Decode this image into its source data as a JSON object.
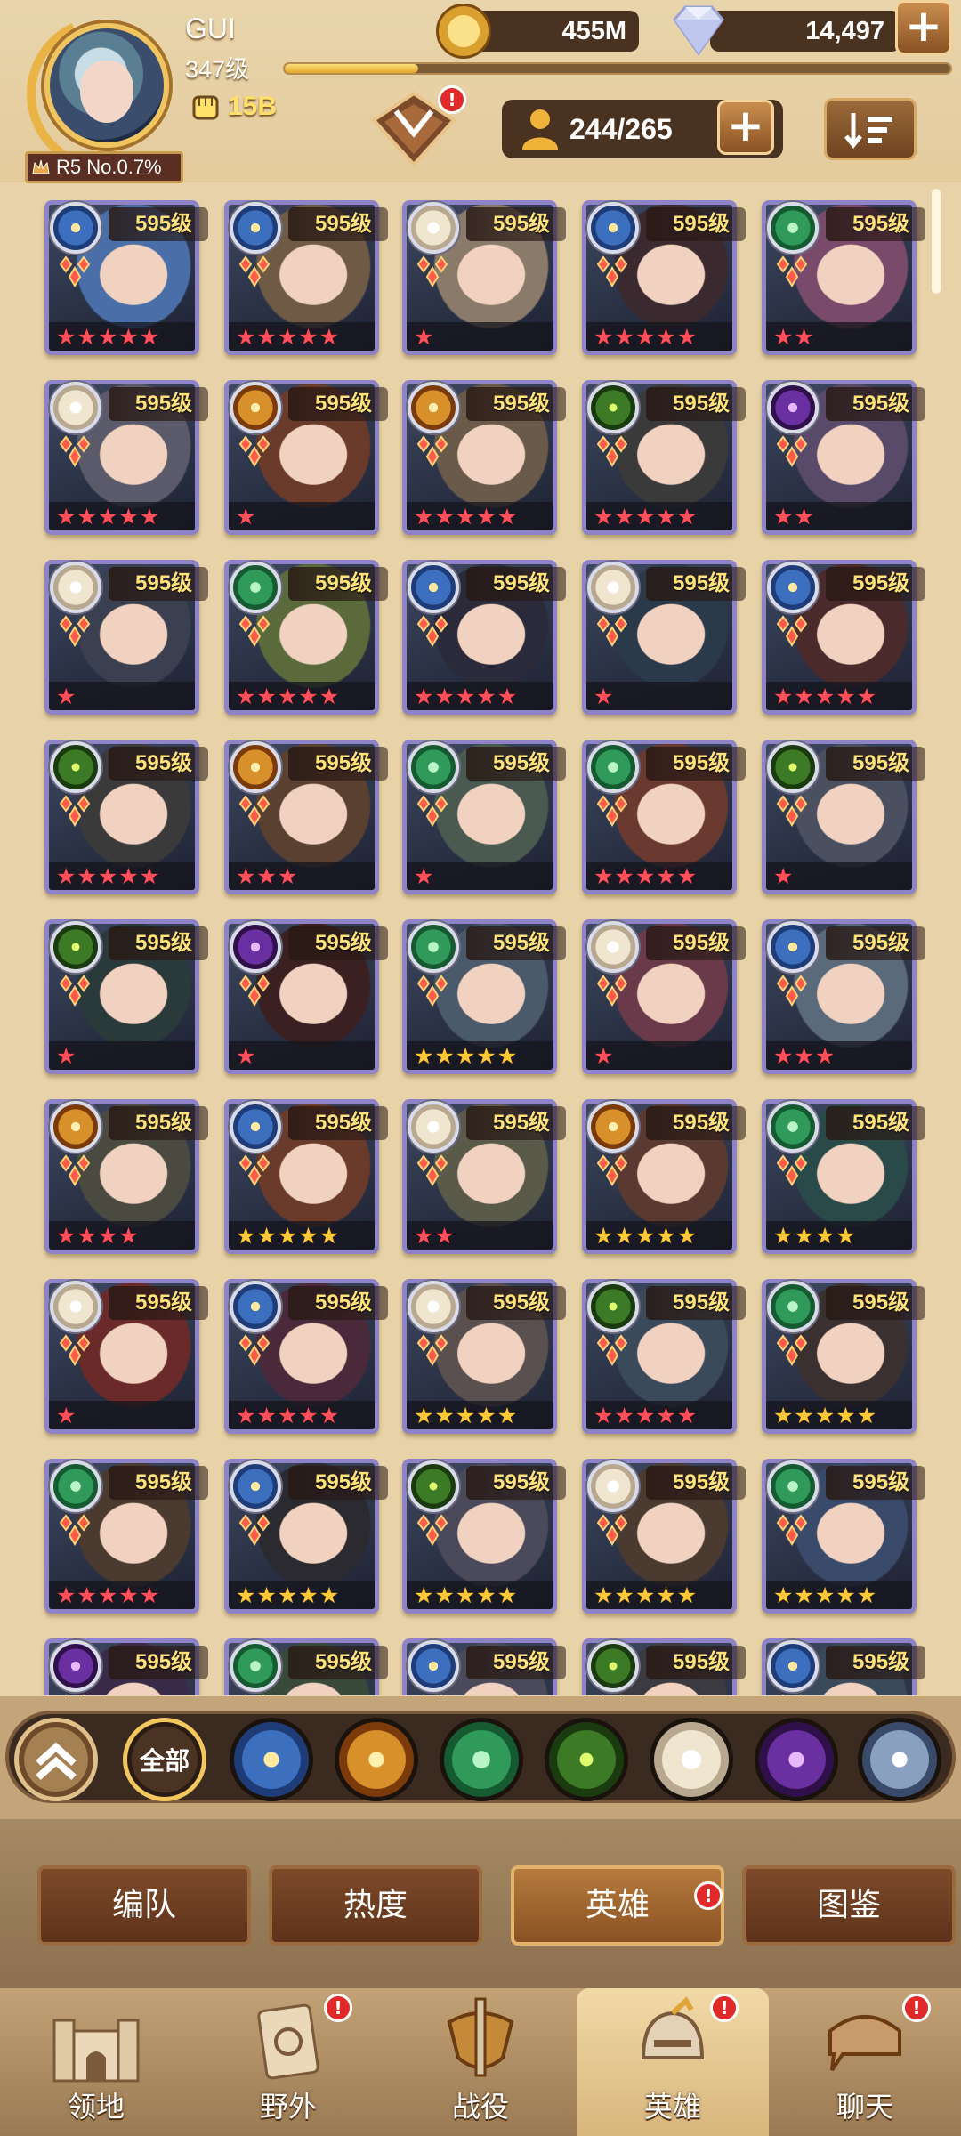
{
  "player": {
    "name": "GUI",
    "level": "347级",
    "power": "15B",
    "rank": "R5 No.0.7%",
    "xp_fraction": 0.2
  },
  "currency": {
    "gold": "455M",
    "gems": "14,497"
  },
  "roster": {
    "count": "244/265",
    "badge": "!"
  },
  "colors": {
    "light": "#3d6fbf",
    "mauler": "#c57a1e",
    "wilder": "#2f9a5a",
    "graveborn": "#3c7a25",
    "celestial": "#e8e0d0",
    "hypogean": "#6a2fa0"
  },
  "heroes": [
    {
      "level": "595级",
      "faction": "light",
      "stars": 5,
      "star_color": "red",
      "tone": "#4a6fa8"
    },
    {
      "level": "595级",
      "faction": "light",
      "stars": 5,
      "star_color": "red",
      "tone": "#6e5a45"
    },
    {
      "level": "595级",
      "faction": "celestial",
      "stars": 1,
      "star_color": "red",
      "tone": "#8a7a6a"
    },
    {
      "level": "595级",
      "faction": "light",
      "stars": 5,
      "star_color": "red",
      "tone": "#3a2a30"
    },
    {
      "level": "595级",
      "faction": "wilder",
      "stars": 2,
      "star_color": "red",
      "tone": "#7a4a6a"
    },
    {
      "level": "595级",
      "faction": "celestial",
      "stars": 5,
      "star_color": "red",
      "tone": "#5a5a6a"
    },
    {
      "level": "595级",
      "faction": "mauler",
      "stars": 1,
      "star_color": "red",
      "tone": "#6a3a2a"
    },
    {
      "level": "595级",
      "faction": "mauler",
      "stars": 5,
      "star_color": "red",
      "tone": "#6a5a4a"
    },
    {
      "level": "595级",
      "faction": "graveborn",
      "stars": 5,
      "star_color": "red",
      "tone": "#3a3a3a"
    },
    {
      "level": "595级",
      "faction": "hypogean",
      "stars": 2,
      "star_color": "red",
      "tone": "#5a4a6a"
    },
    {
      "level": "595级",
      "faction": "celestial",
      "stars": 1,
      "star_color": "red",
      "tone": "#3a4050"
    },
    {
      "level": "595级",
      "faction": "wilder",
      "stars": 5,
      "star_color": "red",
      "tone": "#5a6a3a"
    },
    {
      "level": "595级",
      "faction": "light",
      "stars": 5,
      "star_color": "red",
      "tone": "#2a2a3a"
    },
    {
      "level": "595级",
      "faction": "celestial",
      "stars": 1,
      "star_color": "red",
      "tone": "#2a3a4a"
    },
    {
      "level": "595级",
      "faction": "light",
      "stars": 5,
      "star_color": "red",
      "tone": "#4a2a2a"
    },
    {
      "level": "595级",
      "faction": "graveborn",
      "stars": 5,
      "star_color": "red",
      "tone": "#3a3a3a"
    },
    {
      "level": "595级",
      "faction": "mauler",
      "stars": 3,
      "star_color": "red",
      "tone": "#5a4030"
    },
    {
      "level": "595级",
      "faction": "wilder",
      "stars": 1,
      "star_color": "red",
      "tone": "#4a5a50"
    },
    {
      "level": "595级",
      "faction": "wilder",
      "stars": 5,
      "star_color": "red",
      "tone": "#6a3a30"
    },
    {
      "level": "595级",
      "faction": "graveborn",
      "stars": 1,
      "star_color": "red",
      "tone": "#4a5060"
    },
    {
      "level": "595级",
      "faction": "graveborn",
      "stars": 1,
      "star_color": "red",
      "tone": "#2a3a3a"
    },
    {
      "level": "595级",
      "faction": "hypogean",
      "stars": 1,
      "star_color": "red",
      "tone": "#3a2020"
    },
    {
      "level": "595级",
      "faction": "wilder",
      "stars": 5,
      "star_color": "gold",
      "tone": "#4a5a6a"
    },
    {
      "level": "595级",
      "faction": "celestial",
      "stars": 1,
      "star_color": "red",
      "tone": "#6a3a4a"
    },
    {
      "level": "595级",
      "faction": "light",
      "stars": 3,
      "star_color": "red",
      "tone": "#5a6a7a"
    },
    {
      "level": "595级",
      "faction": "mauler",
      "stars": 4,
      "star_color": "red",
      "tone": "#4a4a40"
    },
    {
      "level": "595级",
      "faction": "light",
      "stars": 5,
      "star_color": "gold",
      "tone": "#6a3a2a"
    },
    {
      "level": "595级",
      "faction": "celestial",
      "stars": 2,
      "star_color": "red",
      "tone": "#5a5a4a"
    },
    {
      "level": "595级",
      "faction": "mauler",
      "stars": 5,
      "star_color": "gold",
      "tone": "#5a3a30"
    },
    {
      "level": "595级",
      "faction": "wilder",
      "stars": 4,
      "star_color": "gold",
      "tone": "#2a4a4a"
    },
    {
      "level": "595级",
      "faction": "celestial",
      "stars": 1,
      "star_color": "red",
      "tone": "#6a2a2a"
    },
    {
      "level": "595级",
      "faction": "light",
      "stars": 5,
      "star_color": "red",
      "tone": "#4a2a3a"
    },
    {
      "level": "595级",
      "faction": "celestial",
      "stars": 5,
      "star_color": "gold",
      "tone": "#5a5050"
    },
    {
      "level": "595级",
      "faction": "graveborn",
      "stars": 5,
      "star_color": "red",
      "tone": "#3a4a5a"
    },
    {
      "level": "595级",
      "faction": "wilder",
      "stars": 5,
      "star_color": "gold",
      "tone": "#3a3030"
    },
    {
      "level": "595级",
      "faction": "wilder",
      "stars": 5,
      "star_color": "red",
      "tone": "#4a3a30"
    },
    {
      "level": "595级",
      "faction": "light",
      "stars": 5,
      "star_color": "gold",
      "tone": "#2a2a30"
    },
    {
      "level": "595级",
      "faction": "graveborn",
      "stars": 5,
      "star_color": "gold",
      "tone": "#4a4a5a"
    },
    {
      "level": "595级",
      "faction": "celestial",
      "stars": 5,
      "star_color": "gold",
      "tone": "#4a3a30"
    },
    {
      "level": "595级",
      "faction": "wilder",
      "stars": 5,
      "star_color": "gold",
      "tone": "#3a4a6a"
    },
    {
      "level": "595级",
      "faction": "hypogean",
      "stars": 0,
      "star_color": "red",
      "tone": "#3a2a4a"
    },
    {
      "level": "595级",
      "faction": "wilder",
      "stars": 0,
      "star_color": "red",
      "tone": "#3a4a3a"
    },
    {
      "level": "595级",
      "faction": "light",
      "stars": 0,
      "star_color": "red",
      "tone": "#4a4a5a"
    },
    {
      "level": "595级",
      "faction": "graveborn",
      "stars": 0,
      "star_color": "red",
      "tone": "#3a3a40"
    },
    {
      "level": "595级",
      "faction": "light",
      "stars": 0,
      "star_color": "red",
      "tone": "#3a4a5a"
    }
  ],
  "filter": {
    "all_label": "全部",
    "factions": [
      "light",
      "mauler",
      "wilder",
      "graveborn",
      "celestial",
      "hypogean",
      "dimensional"
    ]
  },
  "subtabs": [
    {
      "label": "编队",
      "active": false
    },
    {
      "label": "热度",
      "active": false
    },
    {
      "label": "英雄",
      "active": true,
      "badge": "!"
    },
    {
      "label": "图鉴",
      "active": false
    }
  ],
  "nav": [
    {
      "label": "领地",
      "icon": "castle-icon",
      "active": false
    },
    {
      "label": "野外",
      "icon": "scroll-map-icon",
      "active": false,
      "badge": "!"
    },
    {
      "label": "战役",
      "icon": "sword-shield-icon",
      "active": false
    },
    {
      "label": "英雄",
      "icon": "helmet-icon",
      "active": true,
      "badge": "!"
    },
    {
      "label": "聊天",
      "icon": "chat-bubble-icon",
      "active": false,
      "badge": "!"
    }
  ]
}
